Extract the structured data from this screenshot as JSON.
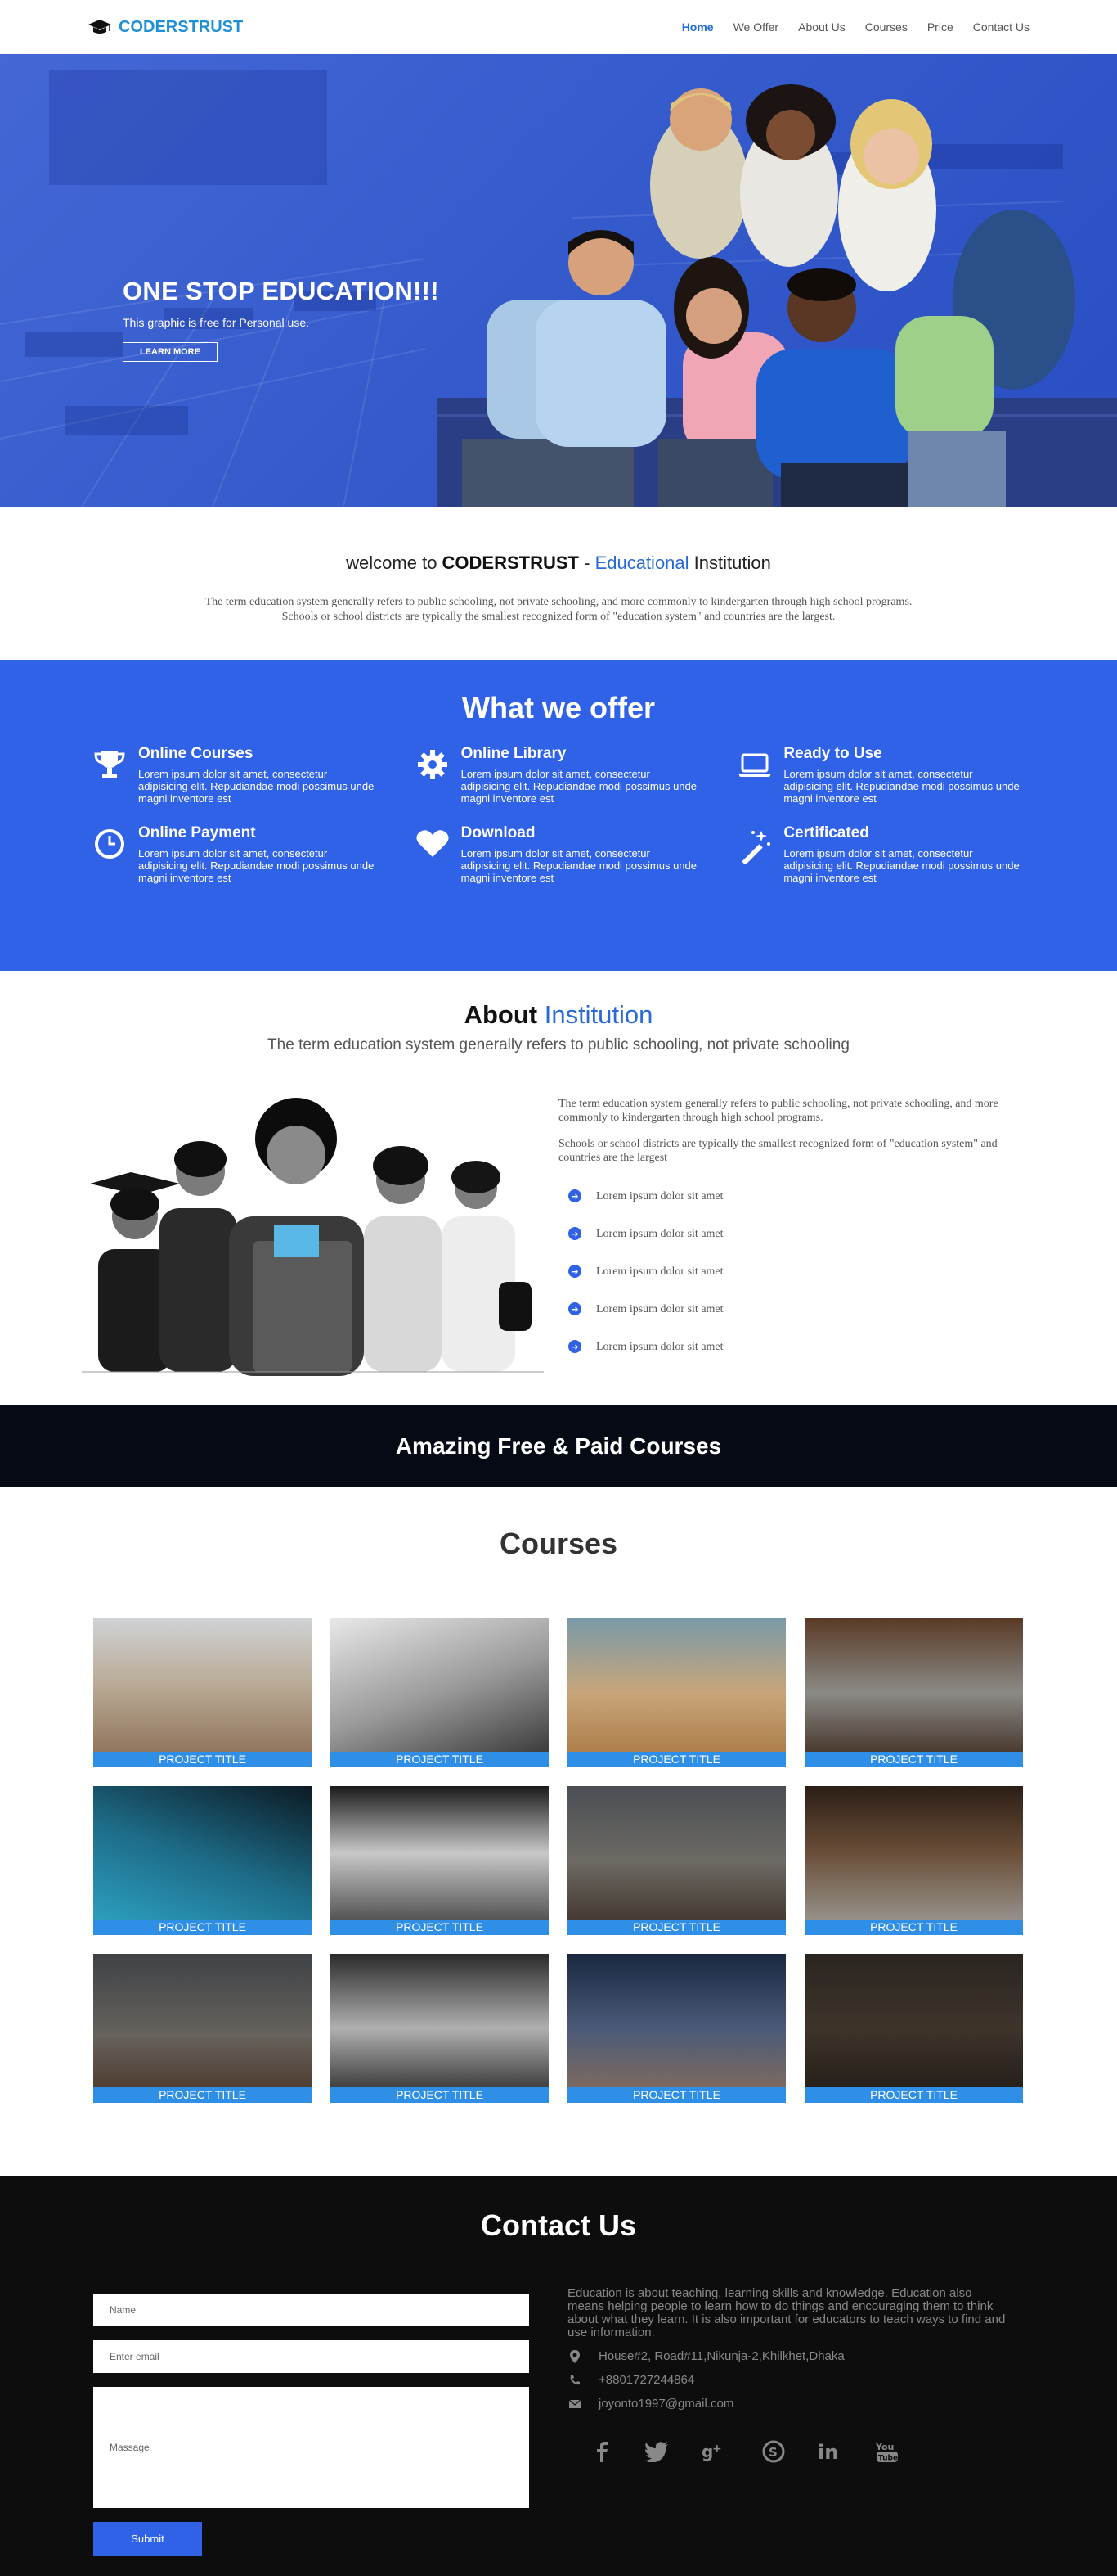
{
  "nav": {
    "brand": "CODERSTRUST",
    "items": [
      {
        "label": "Home",
        "active": true
      },
      {
        "label": "We Offer"
      },
      {
        "label": "About Us"
      },
      {
        "label": "Courses"
      },
      {
        "label": "Price"
      },
      {
        "label": "Contact Us"
      }
    ]
  },
  "hero": {
    "title": "ONE STOP EDUCATION!!!",
    "subtitle": "This graphic is free for Personal use.",
    "button": "LEARN MORE"
  },
  "welcome": {
    "prefix": "welcome to ",
    "brand": "CODERSTRUST",
    "dash": " - ",
    "highlight": "Educational",
    "suffix": " Institution",
    "line1": "The term education system generally refers to public schooling, not private schooling, and more commonly to kindergarten through high school programs.",
    "line2": "Schools or school districts are typically the smallest recognized form of \"education system\" and countries are the largest."
  },
  "offer": {
    "title": "What we offer",
    "items": [
      {
        "title": "Online Courses",
        "icon": "trophy-icon",
        "text": "Lorem ipsum dolor sit amet, consectetur adipisicing elit. Repudiandae modi possimus unde magni inventore est"
      },
      {
        "title": "Online Library",
        "icon": "gear-icon",
        "text": "Lorem ipsum dolor sit amet, consectetur adipisicing elit. Repudiandae modi possimus unde magni inventore est"
      },
      {
        "title": "Ready to Use",
        "icon": "laptop-icon",
        "text": "Lorem ipsum dolor sit amet, consectetur adipisicing elit. Repudiandae modi possimus unde magni inventore est"
      },
      {
        "title": "Online Payment",
        "icon": "clock-icon",
        "text": "Lorem ipsum dolor sit amet, consectetur adipisicing elit. Repudiandae modi possimus unde magni inventore est"
      },
      {
        "title": "Download",
        "icon": "heart-icon",
        "text": "Lorem ipsum dolor sit amet, consectetur adipisicing elit. Repudiandae modi possimus unde magni inventore est"
      },
      {
        "title": "Certificated",
        "icon": "magic-wand-icon",
        "text": "Lorem ipsum dolor sit amet, consectetur adipisicing elit. Repudiandae modi possimus unde magni inventore est"
      }
    ]
  },
  "about": {
    "title_a": "About ",
    "title_b": "Institution",
    "subtitle": "The term education system generally refers to public schooling, not private schooling",
    "p1": "The term education system generally refers to public schooling, not private schooling, and more commonly to kindergarten through high school programs.",
    "p2": "Schools or school districts are typically the smallest recognized form of \"education system\" and countries are the largest",
    "list": [
      "Lorem ipsum dolor sit amet",
      "Lorem ipsum dolor sit amet",
      "Lorem ipsum dolor sit amet",
      "Lorem ipsum dolor sit amet",
      "Lorem ipsum dolor sit amet"
    ]
  },
  "banner": {
    "title": "Amazing Free & Paid Courses"
  },
  "courses": {
    "title": "Courses",
    "cards": [
      {
        "caption": "PROJECT TITLE"
      },
      {
        "caption": "PROJECT TITLE"
      },
      {
        "caption": "PROJECT TITLE"
      },
      {
        "caption": "PROJECT TITLE"
      },
      {
        "caption": "PROJECT TITLE"
      },
      {
        "caption": "PROJECT TITLE"
      },
      {
        "caption": "PROJECT TITLE"
      },
      {
        "caption": "PROJECT TITLE"
      },
      {
        "caption": "PROJECT TITLE"
      },
      {
        "caption": "PROJECT TITLE"
      },
      {
        "caption": "PROJECT TITLE"
      },
      {
        "caption": "PROJECT TITLE"
      }
    ]
  },
  "contact": {
    "title": "Contact Us",
    "name_placeholder": "Name",
    "email_placeholder": "Enter email",
    "message_placeholder": "Massage",
    "submit": "Submit",
    "description": "Education is about teaching, learning skills and knowledge. Education also means helping people to learn how to do things and encouraging them to think about what they learn. It is also important for educators to teach ways to find and use information.",
    "address": "House#2, Road#11,Nikunja-2,Khilkhet,Dhaka",
    "phone": "+8801727244864",
    "email": "joyonto1997@gmail.com",
    "social": [
      "facebook-icon",
      "twitter-icon",
      "google-plus-icon",
      "skype-icon",
      "linkedin-icon",
      "youtube-icon"
    ]
  },
  "colors": {
    "accent": "#2f62e6",
    "brand": "#1f8fd6",
    "banner_bg": "#050a14",
    "contact_bg": "#0d0d0d"
  }
}
